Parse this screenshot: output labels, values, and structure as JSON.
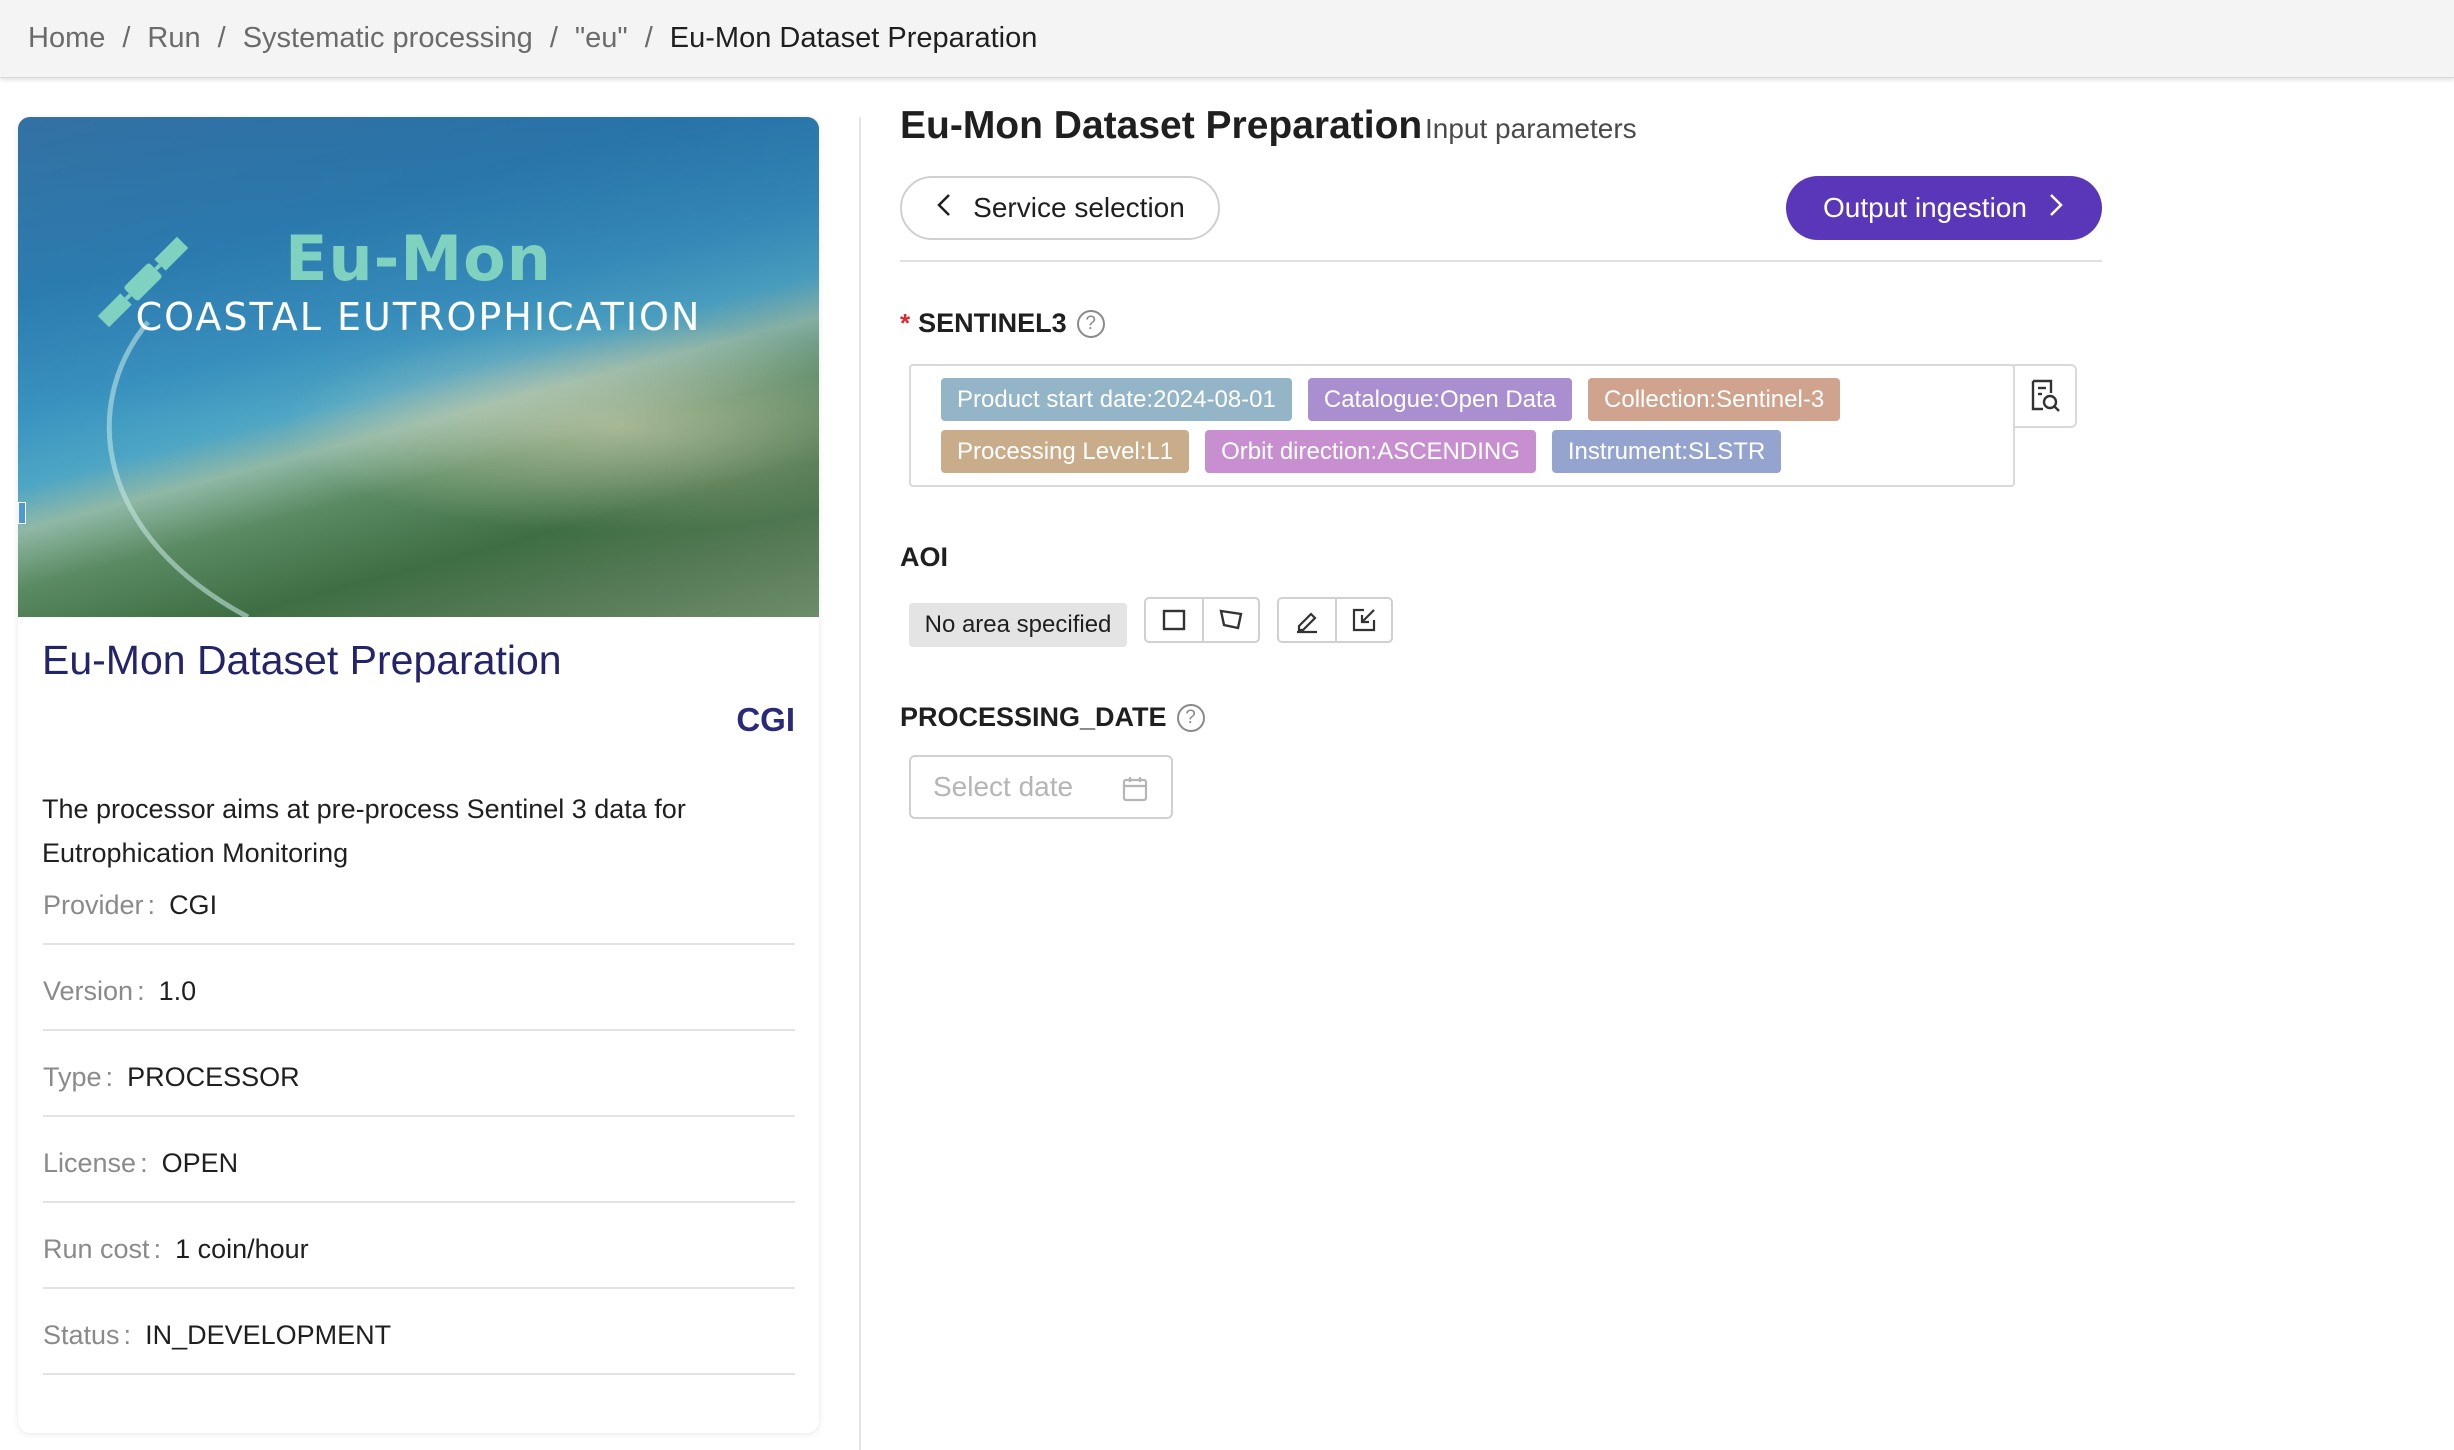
{
  "breadcrumb": {
    "items": [
      "Home",
      "Run",
      "Systematic processing",
      "\"eu\"",
      "Eu-Mon Dataset Preparation"
    ],
    "separator": "/"
  },
  "service_card": {
    "hero_title": "Eu-Mon",
    "hero_subtitle": "COASTAL EUTROPHICATION",
    "name": "Eu-Mon Dataset Preparation",
    "provider_logo": "CGI",
    "description": "The processor aims at pre-process Sentinel 3 data for Eutrophication Monitoring",
    "details": [
      {
        "key": "Provider",
        "value": "CGI"
      },
      {
        "key": "Version",
        "value": "1.0"
      },
      {
        "key": "Type",
        "value": "PROCESSOR"
      },
      {
        "key": "License",
        "value": "OPEN"
      },
      {
        "key": "Run cost",
        "value": "1 coin/hour"
      },
      {
        "key": "Status",
        "value": "IN_DEVELOPMENT"
      }
    ]
  },
  "panel": {
    "title": "Eu-Mon Dataset Preparation",
    "subtitle": "Input parameters",
    "back_button": "Service selection",
    "next_button": "Output ingestion"
  },
  "fields": {
    "sentinel3": {
      "label": "SENTINEL3",
      "required_mark": "*",
      "help": "?",
      "tags": [
        {
          "text": "Product start date:2024-08-01",
          "color": "#94b4c8"
        },
        {
          "text": "Catalogue:Open Data",
          "color": "#a98fcf"
        },
        {
          "text": "Collection:Sentinel-3",
          "color": "#cfa38e"
        },
        {
          "text": "Processing Level:L1",
          "color": "#c9ac8a"
        },
        {
          "text": "Orbit direction:ASCENDING",
          "color": "#c78fcf"
        },
        {
          "text": "Instrument:SLSTR",
          "color": "#94a4cf"
        }
      ]
    },
    "aoi": {
      "label": "AOI",
      "value": "No area specified"
    },
    "processing_date": {
      "label": "PROCESSING_DATE",
      "help": "?",
      "placeholder": "Select date"
    }
  },
  "icons": {
    "back": "chevron-left-icon",
    "next": "chevron-right-icon",
    "catalog": "catalog-search-icon",
    "draw_rectangle": "rectangle-icon",
    "draw_polygon": "polygon-icon",
    "edit": "pencil-icon",
    "import": "import-icon",
    "calendar": "calendar-icon"
  },
  "colors": {
    "accent": "#5a37b8",
    "card_title": "#24246b",
    "required": "#e0282e"
  }
}
